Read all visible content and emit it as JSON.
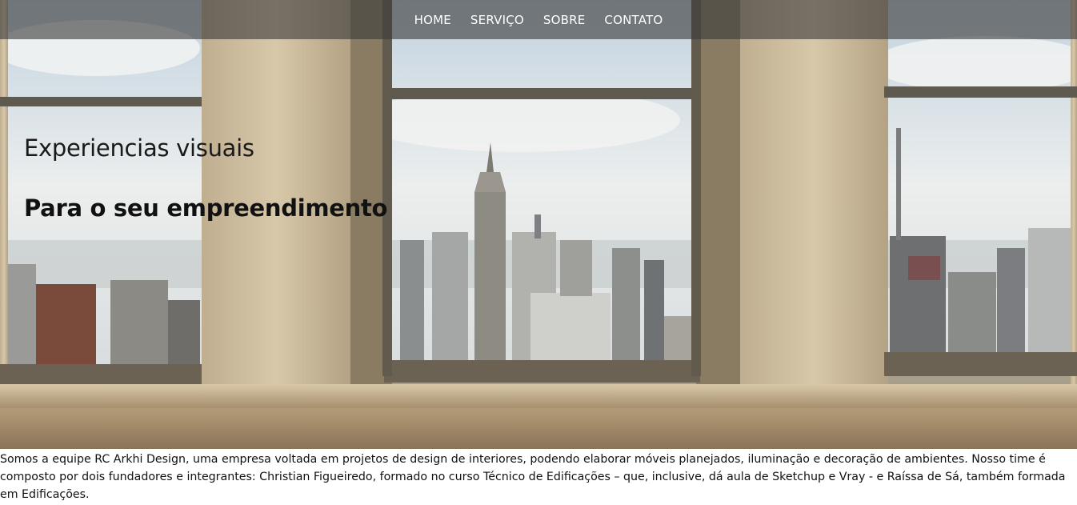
{
  "nav": {
    "items": [
      {
        "label": "HOME"
      },
      {
        "label": "SERVIÇO"
      },
      {
        "label": "SOBRE"
      },
      {
        "label": "CONTATO"
      }
    ]
  },
  "hero": {
    "title": "Experiencias visuais",
    "subtitle": "Para o seu empreendimento"
  },
  "about": {
    "text": "Somos a equipe RC Arkhi Design, uma empresa voltada em projetos de design de interiores, podendo elaborar móveis planejados, iluminação e decoração de ambientes. Nosso time é composto por dois fundadores e integrantes: Christian Figueiredo, formado no curso Técnico de Edificações – que, inclusive, dá aula de Sketchup e Vray - e Raíssa de Sá, também formada em Edificações."
  },
  "colors": {
    "nav_bg": "#3c3c3c",
    "nav_text": "#ffffff",
    "wall": "#c9b79a",
    "frame": "#6e6556"
  }
}
